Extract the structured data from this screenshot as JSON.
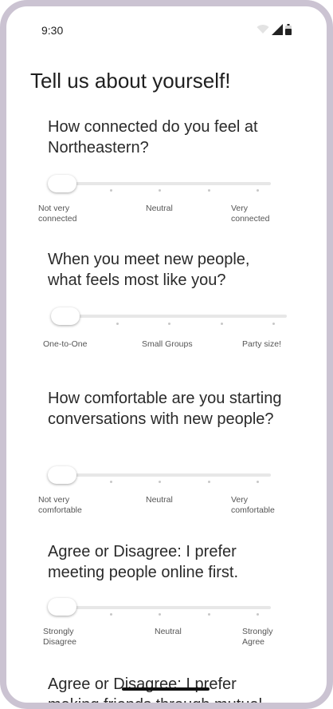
{
  "status_bar": {
    "time": "9:30"
  },
  "page": {
    "title": "Tell us about yourself!"
  },
  "questions": [
    {
      "text": "How connected do you feel at Northeastern?",
      "value": 0,
      "labels": [
        "Not very connected",
        "Neutral",
        "Very connected"
      ]
    },
    {
      "text": "When you meet new people, what feels most like you?",
      "value": 0,
      "labels": [
        "One-to-One",
        "Small Groups",
        "Party size!"
      ]
    },
    {
      "text": "How comfortable are you starting conversations with new people?",
      "value": 0,
      "labels": [
        "Not very comfortable",
        "Neutral",
        "Very comfortable"
      ]
    },
    {
      "text": "Agree or Disagree: I prefer meeting people online first.",
      "value": 0,
      "labels": [
        "Strongly Disagree",
        "Neutral",
        "Strongly Agree"
      ]
    },
    {
      "text": "Agree or Disagree: I prefer making friends through mutual"
    }
  ]
}
